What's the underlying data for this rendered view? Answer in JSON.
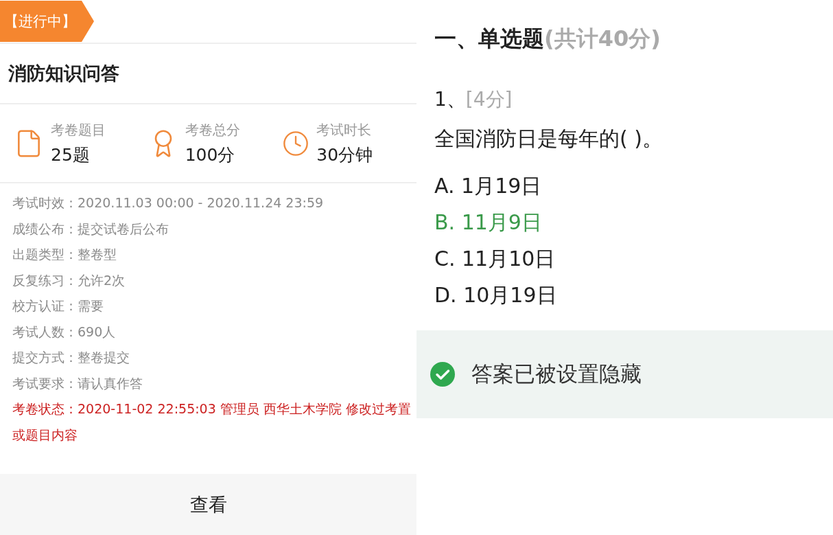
{
  "left": {
    "status_tag": "【进行中】",
    "title": "消防知识问答",
    "stats": [
      {
        "kind": "document",
        "label": "考卷题目",
        "value": "25题"
      },
      {
        "kind": "award",
        "label": "考卷总分",
        "value": "100分"
      },
      {
        "kind": "clock",
        "label": "考试时长",
        "value": "30分钟"
      }
    ],
    "info": [
      {
        "kind": "normal",
        "text": "考试时效：2020.11.03 00:00 - 2020.11.24 23:59"
      },
      {
        "kind": "normal",
        "text": "成绩公布：提交试卷后公布"
      },
      {
        "kind": "normal",
        "text": "出题类型：整卷型"
      },
      {
        "kind": "normal",
        "text": "反复练习：允许2次"
      },
      {
        "kind": "normal",
        "text": "校方认证：需要"
      },
      {
        "kind": "normal",
        "text": "考试人数：690人"
      },
      {
        "kind": "normal",
        "text": "提交方式：整卷提交"
      },
      {
        "kind": "normal",
        "text": "考试要求：请认真作答"
      },
      {
        "kind": "warning",
        "text": "考卷状态：2020-11-02 22:55:03 管理员 西华土木学院 修改过考置或题目内容"
      }
    ],
    "view_button": "查看"
  },
  "right": {
    "section_title": "一、单选题",
    "section_score": "(共计40分)",
    "question_number": "1、",
    "question_score": "[4分]",
    "question": "全国消防日是每年的( )。",
    "options": [
      {
        "text": "A. 1月19日",
        "correct": false
      },
      {
        "text": "B. 11月9日",
        "correct": true
      },
      {
        "text": "C. 11月10日",
        "correct": false
      },
      {
        "text": "D. 10月19日",
        "correct": false
      }
    ],
    "answer_notice": "答案已被设置隐藏"
  }
}
